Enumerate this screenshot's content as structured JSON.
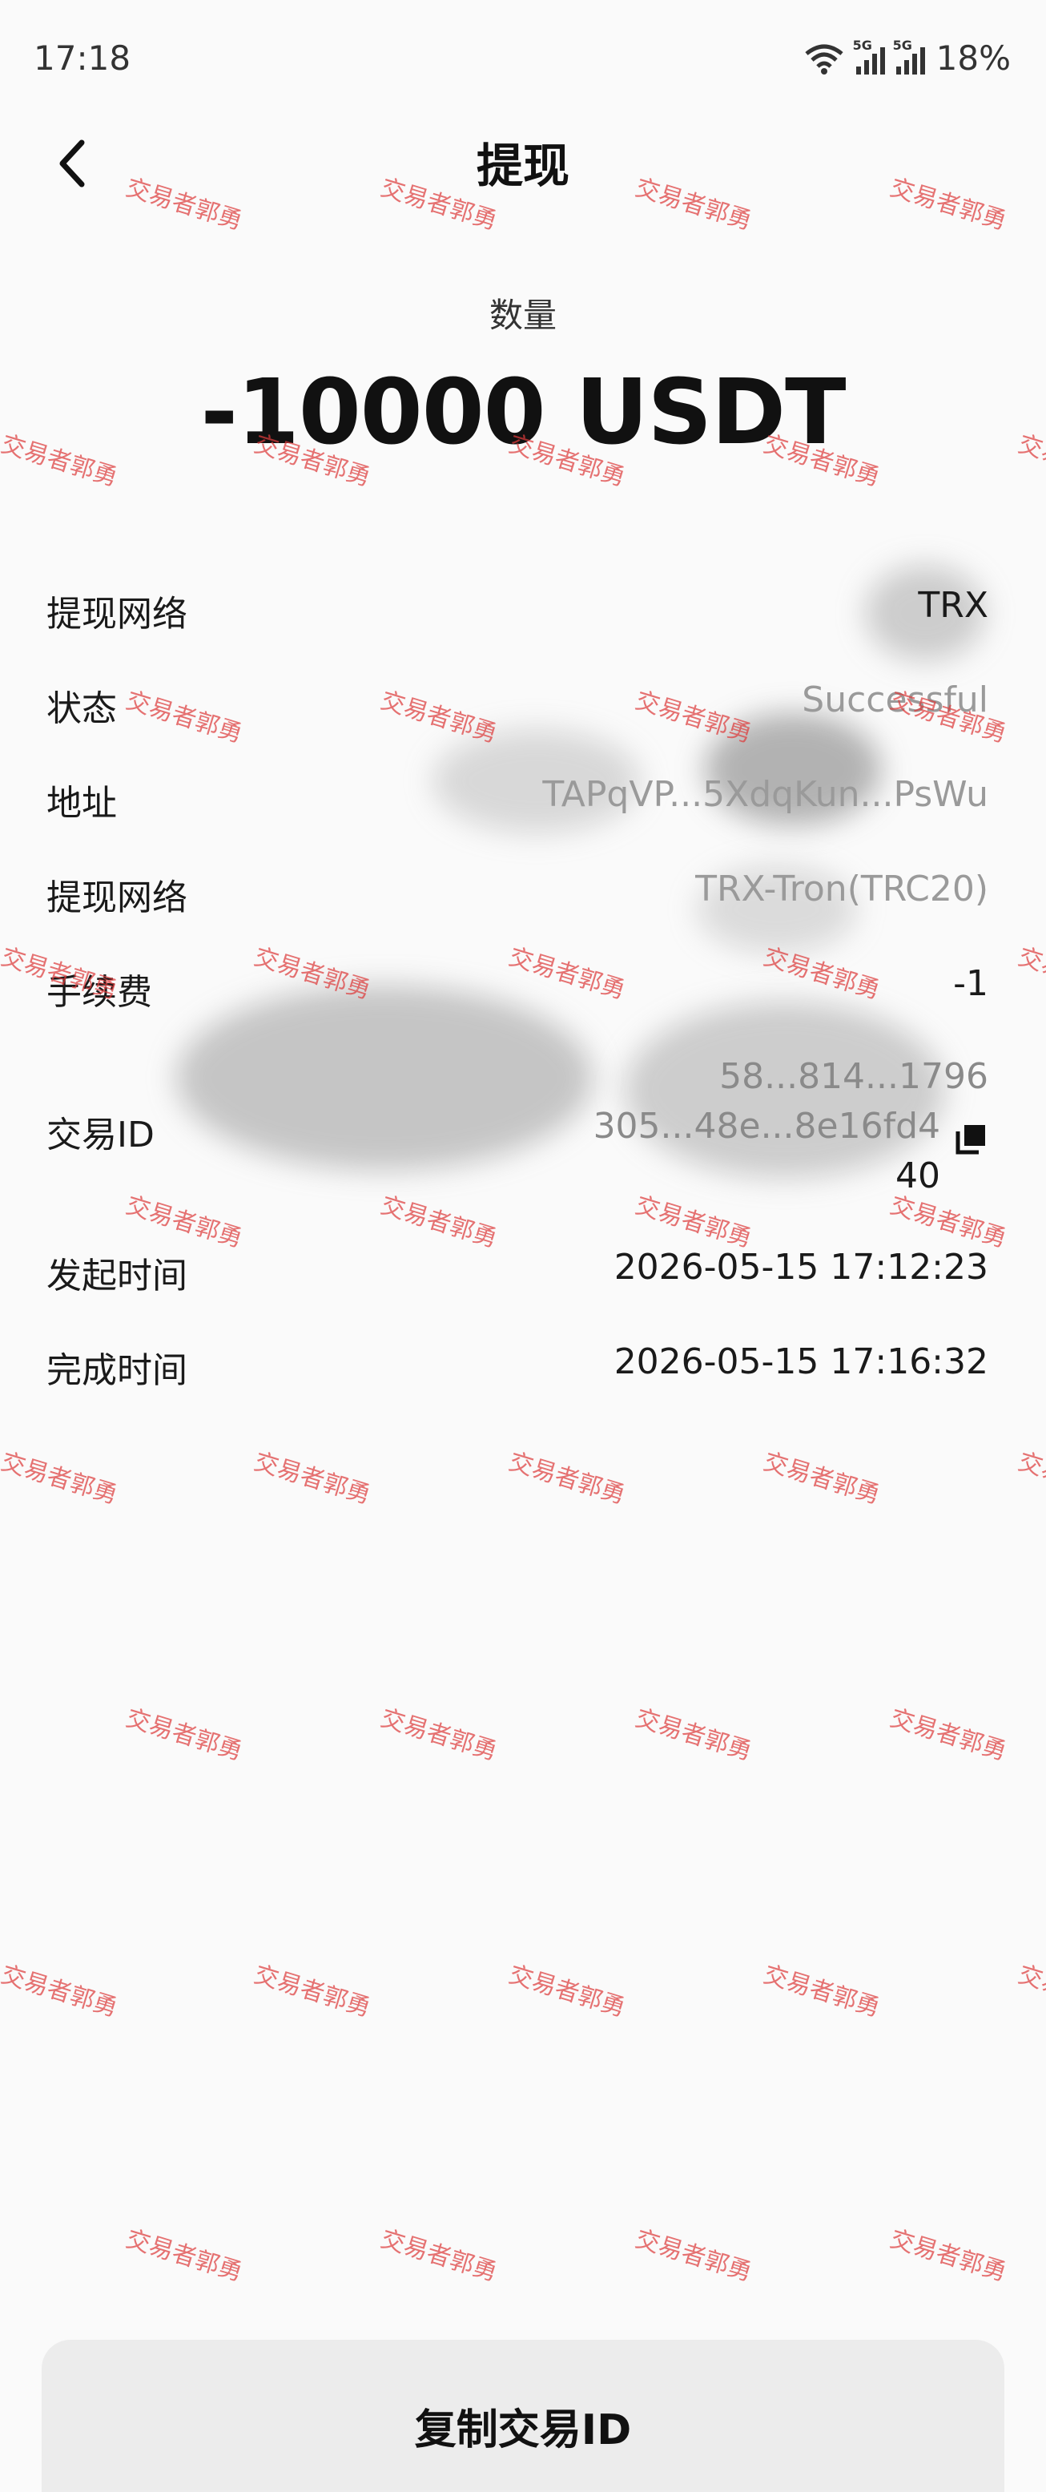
{
  "status_bar": {
    "time": "17:18",
    "network_1": "5G",
    "network_2": "5G",
    "battery": "18%"
  },
  "header": {
    "title": "提现",
    "back_icon": "chevron-left-icon"
  },
  "amount": {
    "label": "数量",
    "value": "-10000 USDT"
  },
  "details": {
    "network_label": "提现网络",
    "network_value": "TRX",
    "status_label": "状态",
    "status_value": "Successful",
    "address_label": "地址",
    "address_value": "TAPqVP...5XdqKun...PsWu",
    "chain_label": "提现网络",
    "chain_value": "TRX-Tron(TRC20)",
    "fee_label": "手续费",
    "fee_value": "-1",
    "txid_label": "交易ID",
    "txid_line1": "58...814...1796",
    "txid_line2": "305...48e...8e16fd4",
    "txid_line3": "40",
    "start_time_label": "发起时间",
    "start_time_value": "2026-05-15 17:12:23",
    "end_time_label": "完成时间",
    "end_time_value": "2026-05-15 17:16:32"
  },
  "watermark_text": "交易者郭勇",
  "footer": {
    "copy_button": "复制交易ID"
  },
  "colors": {
    "watermark": "#dc3c3c",
    "background": "#fafafa",
    "button_bg": "#ececec"
  }
}
